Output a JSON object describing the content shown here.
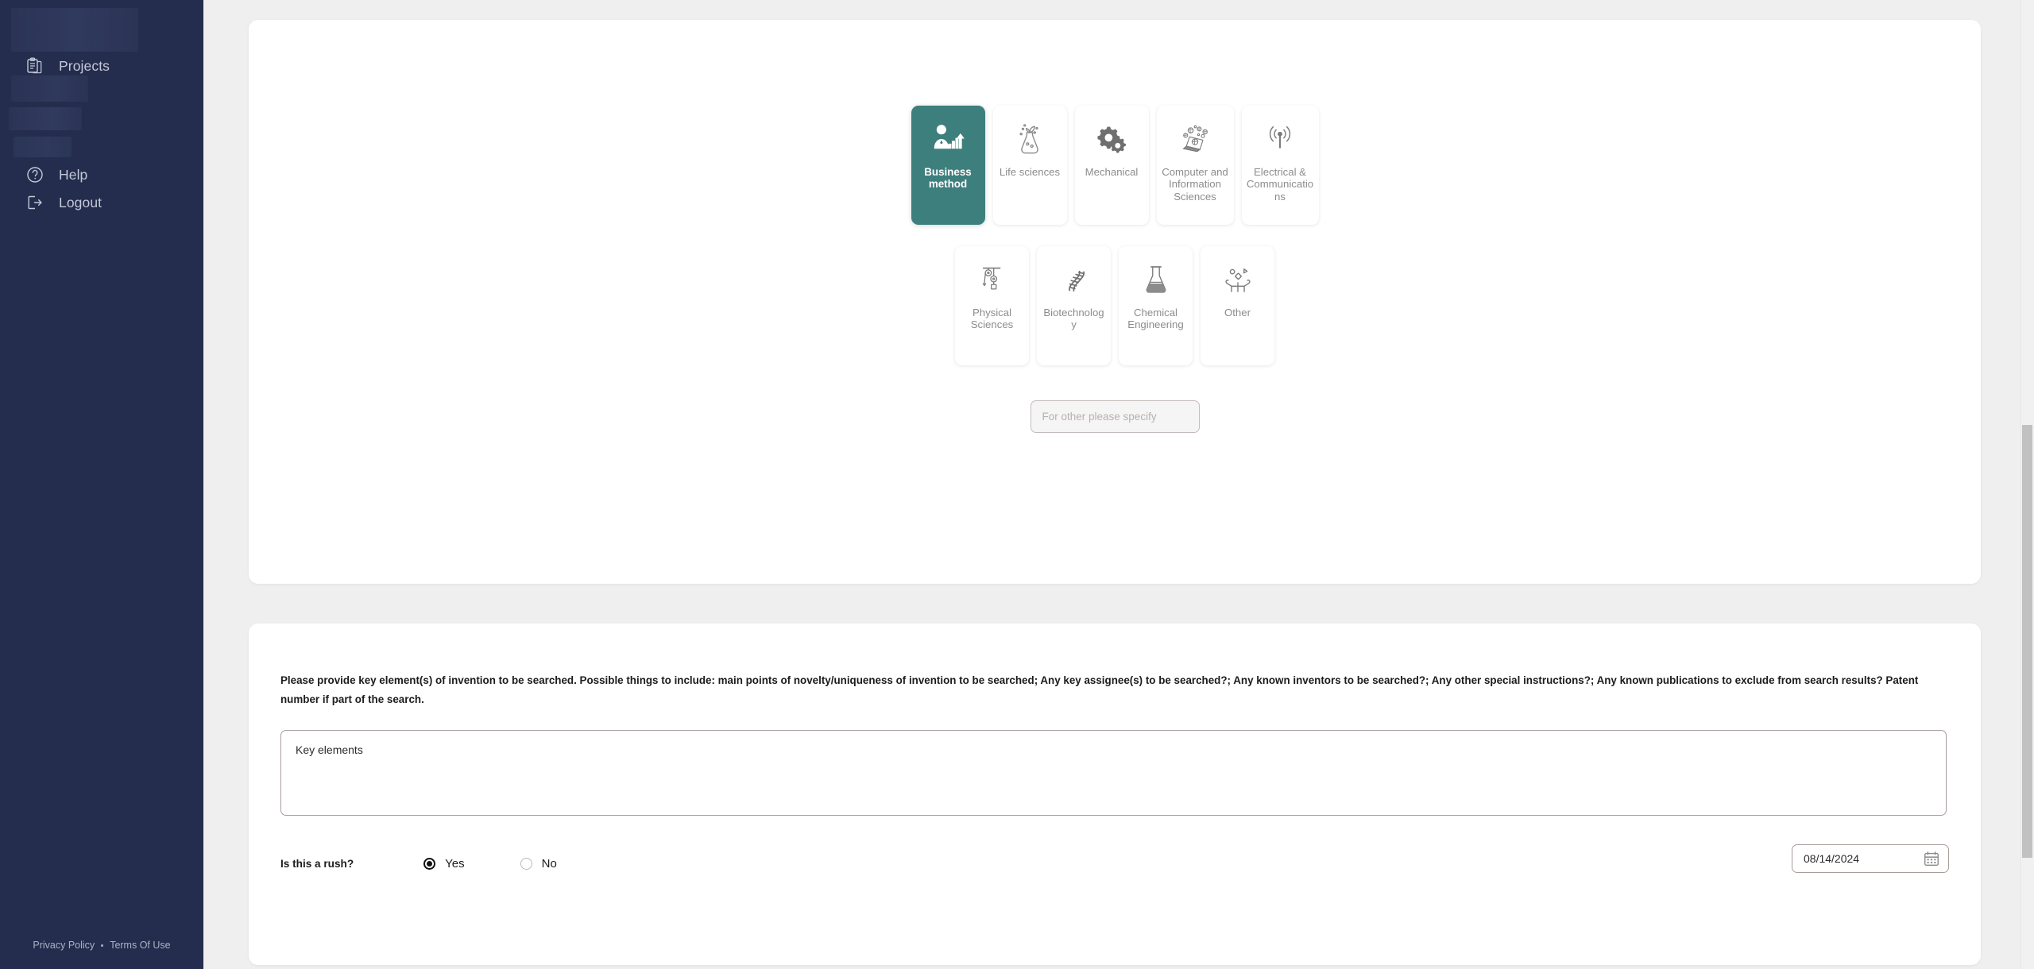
{
  "sidebar": {
    "logo_placeholder": "",
    "nav": [
      {
        "id": "projects",
        "label": "Projects",
        "icon": "clipboard-icon"
      },
      {
        "id": "help",
        "label": "Help",
        "icon": "question-circle-icon"
      },
      {
        "id": "logout",
        "label": "Logout",
        "icon": "logout-icon"
      }
    ],
    "footer": {
      "privacy_label": "Privacy Policy",
      "separator": "•",
      "terms_label": "Terms Of Use"
    }
  },
  "categories": {
    "row1": [
      {
        "id": "business-method",
        "label": "Business method",
        "icon": "business-person-chart-icon",
        "selected": true
      },
      {
        "id": "life-sciences",
        "label": "Life sciences",
        "icon": "plant-flask-icon",
        "selected": false
      },
      {
        "id": "mechanical",
        "label": "Mechanical",
        "icon": "gears-icon",
        "selected": false
      },
      {
        "id": "computer-information-sciences",
        "label": "Computer and Information Sciences",
        "icon": "laptop-globes-icon",
        "selected": false
      },
      {
        "id": "electrical-communications",
        "label": "Electrical & Communications",
        "icon": "antenna-signal-icon",
        "selected": false
      }
    ],
    "row2": [
      {
        "id": "physical-sciences",
        "label": "Physical Sciences",
        "icon": "pulley-icon",
        "selected": false
      },
      {
        "id": "biotechnology",
        "label": "Biotechnology",
        "icon": "dna-helix-icon",
        "selected": false
      },
      {
        "id": "chemical-engineering",
        "label": "Chemical Engineering",
        "icon": "erlenmeyer-flask-icon",
        "selected": false
      },
      {
        "id": "other",
        "label": "Other",
        "icon": "hands-shapes-icon",
        "selected": false
      }
    ],
    "specify_input": {
      "placeholder": "For other please specify",
      "value": ""
    }
  },
  "details": {
    "prompt": "Please provide key element(s) of invention to be searched. Possible things to include: main points of novelty/uniqueness of invention to be searched; Any key assignee(s) to be searched?; Any known inventors to be searched?; Any other special instructions?; Any known publications to exclude from search results? Patent number if part of the search.",
    "key_elements": {
      "value": "Key elements",
      "placeholder": "Key elements"
    },
    "rush": {
      "label": "Is this a rush?",
      "options": [
        {
          "id": "yes",
          "label": "Yes",
          "checked": true
        },
        {
          "id": "no",
          "label": "No",
          "checked": false
        }
      ]
    },
    "date": {
      "value": "08/14/2024",
      "icon": "calendar-icon"
    }
  },
  "colors": {
    "sidebar_navy": "#242d4d",
    "selected_teal": "#3d7f7d",
    "page_background": "#efefef",
    "card_white": "#ffffff",
    "muted_text": "#8c8c8c"
  }
}
